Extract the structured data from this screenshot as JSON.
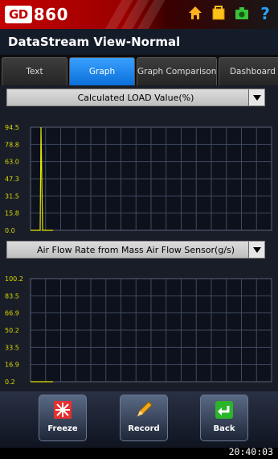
{
  "app": {
    "logo_badge": "GD",
    "logo_number": "860",
    "title": "DataStream View-Normal"
  },
  "top_icons": [
    "home-icon",
    "folder-icon",
    "camera-icon",
    "help-icon"
  ],
  "tabs": [
    {
      "label": "Text",
      "active": false
    },
    {
      "label": "Graph",
      "active": true
    },
    {
      "label": "Graph Comparison",
      "active": false
    },
    {
      "label": "Dashboard",
      "active": false
    }
  ],
  "graphs": [
    {
      "selector": "Calculated LOAD Value(%)",
      "y_ticks": [
        "94.5",
        "78.8",
        "63.0",
        "47.3",
        "31.5",
        "15.8",
        "0.0"
      ],
      "ylim": [
        0.0,
        94.5
      ],
      "spike_value": 94.5
    },
    {
      "selector": "Air Flow Rate from Mass Air Flow Sensor(g/s)",
      "y_ticks": [
        "100.2",
        "83.5",
        "66.9",
        "50.2",
        "33.5",
        "16.9",
        "0.2"
      ],
      "ylim": [
        0.2,
        100.2
      ],
      "spike_value": 0.2
    }
  ],
  "buttons": [
    {
      "label": "Freeze"
    },
    {
      "label": "Record"
    },
    {
      "label": "Back"
    }
  ],
  "status": {
    "time": "20:40:03"
  },
  "colors": {
    "accent_red": "#c40000",
    "tab_active": "#1a85f0",
    "trace": "#e5e500",
    "grid": "#3f4a5e"
  }
}
